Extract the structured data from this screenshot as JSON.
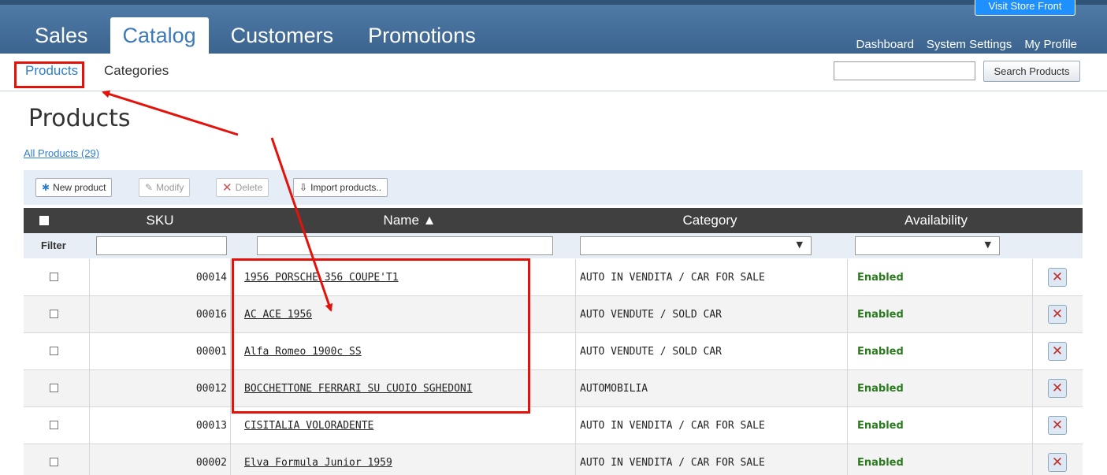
{
  "header": {
    "tabs": [
      "Sales",
      "Catalog",
      "Customers",
      "Promotions"
    ],
    "store_button": "Visit Store Front",
    "links": [
      "Dashboard",
      "System Settings",
      "My Profile"
    ]
  },
  "subnav": {
    "items": [
      "Products",
      "Categories"
    ],
    "search_placeholder": "",
    "search_button": "Search Products"
  },
  "page": {
    "title": "Products",
    "all_products_link": "All Products (29)"
  },
  "toolbar": {
    "new_product": "New product",
    "modify": "Modify",
    "delete": "Delete",
    "import": "Import products.."
  },
  "table": {
    "headers": {
      "sku": "SKU",
      "name": "Name ▲",
      "category": "Category",
      "availability": "Availability"
    },
    "filter_label": "Filter",
    "rows": [
      {
        "sku": "00014",
        "name": "1956 PORSCHE 356 COUPE'T1",
        "category": "AUTO IN VENDITA / CAR FOR SALE",
        "availability": "Enabled"
      },
      {
        "sku": "00016",
        "name": "AC ACE 1956",
        "category": "AUTO VENDUTE / SOLD CAR",
        "availability": "Enabled"
      },
      {
        "sku": "00001",
        "name": "Alfa Romeo 1900c SS",
        "category": "AUTO VENDUTE / SOLD CAR",
        "availability": "Enabled"
      },
      {
        "sku": "00012",
        "name": "BOCCHETTONE FERRARI SU CUOIO SGHEDONI",
        "category": "AUTOMOBILIA",
        "availability": "Enabled"
      },
      {
        "sku": "00013",
        "name": "CISITALIA VOLORADENTE",
        "category": "AUTO IN VENDITA / CAR FOR SALE",
        "availability": "Enabled"
      },
      {
        "sku": "00002",
        "name": "Elva Formula Junior 1959",
        "category": "AUTO IN VENDITA / CAR FOR SALE",
        "availability": "Enabled"
      }
    ]
  },
  "colors": {
    "header_bg": "#4a75a1",
    "link": "#2f7fcf",
    "enabled": "#2a7a1e",
    "annotation": "#e3120b"
  },
  "icons": [
    "asterisk-icon",
    "pencil-icon",
    "x-icon",
    "import-icon",
    "delete-x-icon",
    "sort-asc-icon",
    "dropdown-arrow-icon"
  ]
}
